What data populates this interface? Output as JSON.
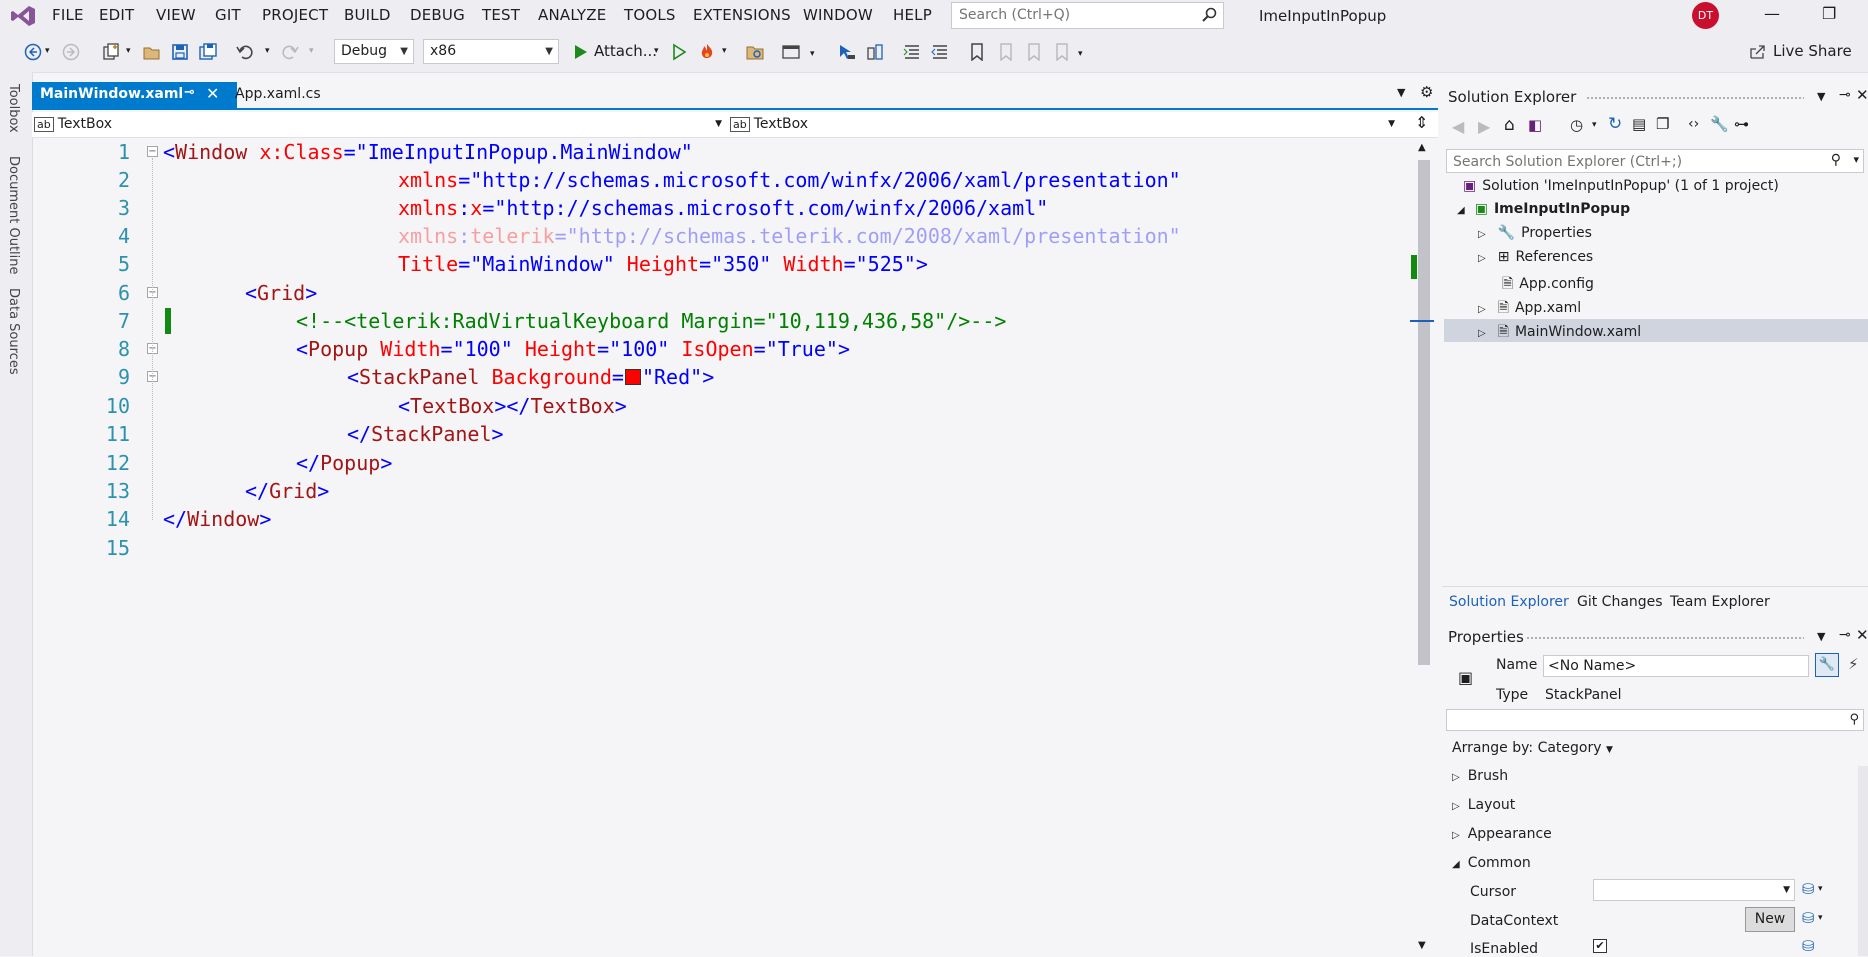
{
  "menu": {
    "items": [
      "FILE",
      "EDIT",
      "VIEW",
      "GIT",
      "PROJECT",
      "BUILD",
      "DEBUG",
      "TEST",
      "ANALYZE",
      "TOOLS",
      "EXTENSIONS",
      "WINDOW",
      "HELP"
    ],
    "search_placeholder": "Search (Ctrl+Q)",
    "window_title": "ImeInputInPopup",
    "avatar": "DT"
  },
  "toolbar": {
    "config": "Debug",
    "platform": "x86",
    "attach": "Attach...",
    "live_share": "Live Share"
  },
  "left_dock": [
    "Toolbox",
    "Document Outline",
    "Data Sources"
  ],
  "tabs": {
    "active": "MainWindow.xaml",
    "other": "App.xaml.cs"
  },
  "navbar": {
    "left": "TextBox",
    "right": "TextBox"
  },
  "code": {
    "line_numbers": [
      "1",
      "2",
      "3",
      "4",
      "5",
      "6",
      "7",
      "8",
      "9",
      "10",
      "11",
      "12",
      "13",
      "14",
      "15"
    ],
    "l1": {
      "a": "<",
      "b": "Window",
      "c": " x:Class",
      "d": "=",
      "e": "\"ImeInputInPopup.MainWindow\""
    },
    "l2": {
      "a": "xmlns",
      "b": "=",
      "c": "\"http://schemas.microsoft.com/winfx/2006/xaml/presentation\""
    },
    "l3": {
      "a": "xmlns",
      "b": ":",
      "c": "x",
      "d": "=",
      "e": "\"http://schemas.microsoft.com/winfx/2006/xaml\""
    },
    "l4": {
      "a": "xmlns",
      "b": ":",
      "c": "telerik",
      "d": "=",
      "e": "\"http://schemas.telerik.com/2008/xaml/presentation\""
    },
    "l5": {
      "a": "Title",
      "b": "=",
      "c": "\"MainWindow\"",
      "d": " Height",
      "e": "=",
      "f": "\"350\"",
      "g": " Width",
      "h": "=",
      "i": "\"525\"",
      "j": ">"
    },
    "l6": {
      "a": "<",
      "b": "Grid",
      "c": ">"
    },
    "l7": "<!--<telerik:RadVirtualKeyboard Margin=\"10,119,436,58\"/>-->",
    "l8": {
      "a": "<",
      "b": "Popup",
      "c": " Width",
      "d": "=",
      "e": "\"100\"",
      "f": " Height",
      "g": "=",
      "h": "\"100\"",
      "i": " IsOpen",
      "j": "=",
      "k": "\"True\"",
      "l": ">"
    },
    "l9": {
      "a": "<",
      "b": "StackPanel",
      "c": " Background",
      "d": "=",
      "e": "\"Red\"",
      "f": ">"
    },
    "l10": {
      "a": "<",
      "b": "TextBox",
      "c": "></",
      "d": "TextBox",
      "e": ">"
    },
    "l11": {
      "a": "</",
      "b": "StackPanel",
      "c": ">"
    },
    "l12": {
      "a": "</",
      "b": "Popup",
      "c": ">"
    },
    "l13": {
      "a": "</",
      "b": "Grid",
      "c": ">"
    },
    "l14": {
      "a": "</",
      "b": "Window",
      "c": ">"
    }
  },
  "solution_explorer": {
    "title": "Solution Explorer",
    "search_placeholder": "Search Solution Explorer (Ctrl+;)",
    "solution": "Solution 'ImeInputInPopup' (1 of 1 project)",
    "project": "ImeInputInPopup",
    "items": [
      "Properties",
      "References",
      "App.config",
      "App.xaml",
      "MainWindow.xaml"
    ],
    "bottom_tabs": [
      "Solution Explorer",
      "Git Changes",
      "Team Explorer"
    ]
  },
  "properties": {
    "title": "Properties",
    "name_label": "Name",
    "name_value": "<No Name>",
    "type_label": "Type",
    "type_value": "StackPanel",
    "arrange": "Arrange by: Category",
    "categories": [
      "Brush",
      "Layout",
      "Appearance",
      "Common"
    ],
    "cursor_label": "Cursor",
    "datacontext_label": "DataContext",
    "new_button": "New",
    "isenabled_label": "IsEnabled"
  },
  "colors": {
    "accent": "#007acc",
    "code_blue": "#0000ff",
    "code_tag": "#a31515",
    "code_attr": "#ff0000",
    "code_comment": "#008000"
  }
}
